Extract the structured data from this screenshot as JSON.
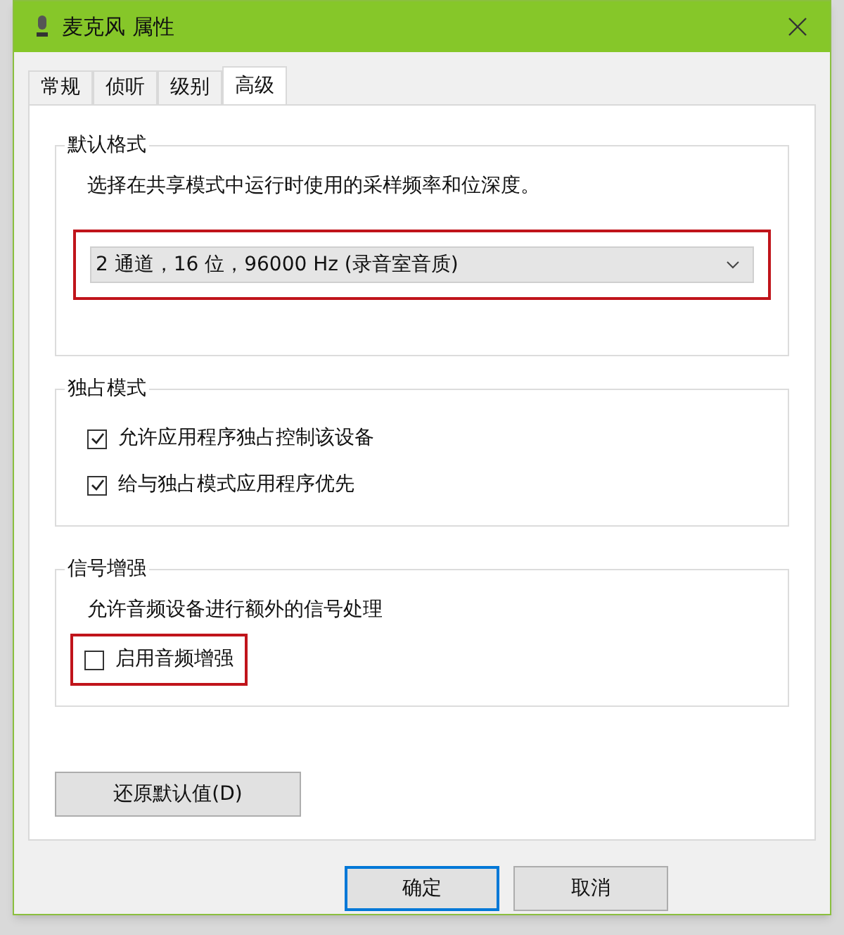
{
  "window": {
    "title": "麦克风 属性"
  },
  "tabs": [
    {
      "label": "常规",
      "selected": false
    },
    {
      "label": "侦听",
      "selected": false
    },
    {
      "label": "级别",
      "selected": false
    },
    {
      "label": "高级",
      "selected": true
    }
  ],
  "default_format": {
    "title": "默认格式",
    "description": "选择在共享模式中运行时使用的采样频率和位深度。",
    "format": {
      "value": "2 通道，16 位，96000 Hz (录音室音质)",
      "highlighted": true
    }
  },
  "exclusive_mode": {
    "title": "独占模式",
    "options": [
      {
        "label": "允许应用程序独占控制该设备",
        "checked": true,
        "highlighted": false
      },
      {
        "label": "给与独占模式应用程序优先",
        "checked": true,
        "highlighted": false
      }
    ]
  },
  "signal_enhancement": {
    "title": "信号增强",
    "description": "允许音频设备进行额外的信号处理",
    "options": [
      {
        "label": "启用音频增强",
        "checked": false,
        "highlighted": true
      }
    ]
  },
  "restore_button": "还原默认值(D)",
  "buttons": [
    {
      "label": "确定",
      "default": true
    },
    {
      "label": "取消",
      "default": false
    }
  ]
}
